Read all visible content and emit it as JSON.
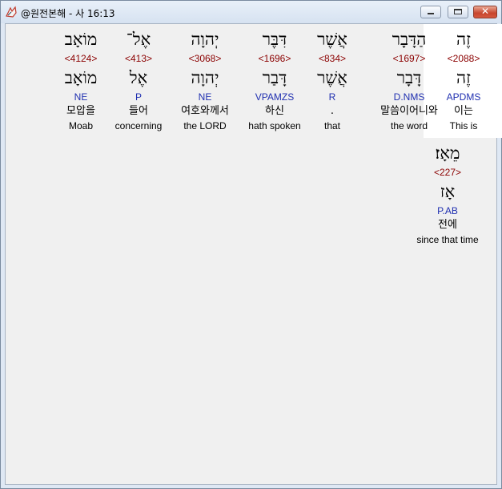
{
  "window": {
    "title": "@원전본해 - 사 16:13",
    "close_glyph": "✕"
  },
  "words": [
    {
      "id": "zeh",
      "hebrew": "זֶה",
      "strong": "<2088>",
      "lemma": "זֶה",
      "parse": "APDMS",
      "korean": "이는",
      "english": "This is",
      "highlighted": true
    },
    {
      "id": "hadavar",
      "hebrew": "הַדָּבָר",
      "strong": "<1697>",
      "lemma": "דָּבָר",
      "parse": "D.NMS",
      "korean": "말씀이어니와",
      "english": "the word",
      "highlighted": false
    },
    {
      "id": "asher",
      "hebrew": "אֲשֶׁר",
      "strong": "<834>",
      "lemma": "אֲשֶׁר",
      "parse": "R",
      "korean": ".",
      "english": "that",
      "highlighted": false
    },
    {
      "id": "dibber",
      "hebrew": "דִּבֶּר",
      "strong": "<1696>",
      "lemma": "דָּבַר",
      "parse": "VPAMZS",
      "korean": "하신",
      "english": "hath spoken",
      "highlighted": false
    },
    {
      "id": "yhwh",
      "hebrew": "יְהוָה",
      "strong": "<3068>",
      "lemma": "יְהוָה",
      "parse": "NE",
      "korean": "여호와께서",
      "english": "the LORD",
      "highlighted": false
    },
    {
      "id": "el",
      "hebrew": "אֶל־",
      "strong": "<413>",
      "lemma": "אֶל",
      "parse": "P",
      "korean": "들어",
      "english": "concerning",
      "highlighted": false
    },
    {
      "id": "moav",
      "hebrew": "מוֹאָב",
      "strong": "<4124>",
      "lemma": "מוֹאָב",
      "parse": "NE",
      "korean": "모압을",
      "english": "Moab",
      "highlighted": false
    },
    {
      "id": "meaz",
      "hebrew": "מֵאָז׃",
      "strong": "<227>",
      "lemma": "אָז",
      "parse": "P.AB",
      "korean": "전에",
      "english": "since that time",
      "highlighted": false
    }
  ]
}
